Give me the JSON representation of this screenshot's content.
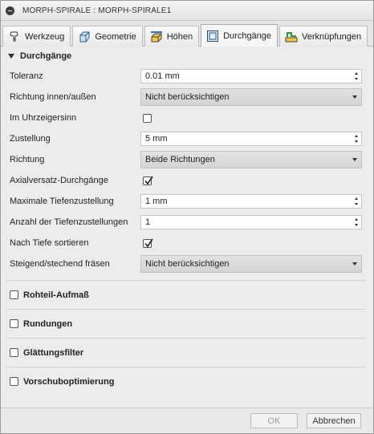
{
  "window": {
    "title": "MORPH-SPIRALE : MORPH-SPIRALE1"
  },
  "tabs": [
    {
      "label": "Werkzeug",
      "icon": "tool-icon",
      "active": false
    },
    {
      "label": "Geometrie",
      "icon": "geometry-icon",
      "active": false
    },
    {
      "label": "Höhen",
      "icon": "heights-icon",
      "active": false
    },
    {
      "label": "Durchgänge",
      "icon": "passes-icon",
      "active": true
    },
    {
      "label": "Verknüpfungen",
      "icon": "linking-icon",
      "active": false
    }
  ],
  "section": {
    "title": "Durchgänge",
    "fields": {
      "toleranz": {
        "label": "Toleranz",
        "value": "0.01 mm"
      },
      "richtung_innen": {
        "label": "Richtung innen/außen",
        "value": "Nicht berücksichtigen"
      },
      "uhrzeigersinn": {
        "label": "Im Uhrzeigersinn",
        "checked": false
      },
      "zustellung": {
        "label": "Zustellung",
        "value": "5 mm"
      },
      "richtung": {
        "label": "Richtung",
        "value": "Beide Richtungen"
      },
      "axialversatz": {
        "label": "Axialversatz-Durchgänge",
        "checked": true
      },
      "max_tiefe": {
        "label": "Maximale Tiefenzustellung",
        "value": "1 mm"
      },
      "anzahl_tiefe": {
        "label": "Anzahl der Tiefenzustellungen",
        "value": "1"
      },
      "nach_tiefe": {
        "label": "Nach Tiefe sortieren",
        "checked": true
      },
      "steigend": {
        "label": "Steigend/stechend fräsen",
        "value": "Nicht berücksichtigen"
      }
    }
  },
  "collapsed_sections": [
    {
      "label": "Rohteil-Aufmaß",
      "checked": false
    },
    {
      "label": "Rundungen",
      "checked": false
    },
    {
      "label": "Glättungsfilter",
      "checked": false
    },
    {
      "label": "Vorschuboptimierung",
      "checked": false
    }
  ],
  "footer": {
    "ok_label": "OK",
    "cancel_label": "Abbrechen"
  }
}
